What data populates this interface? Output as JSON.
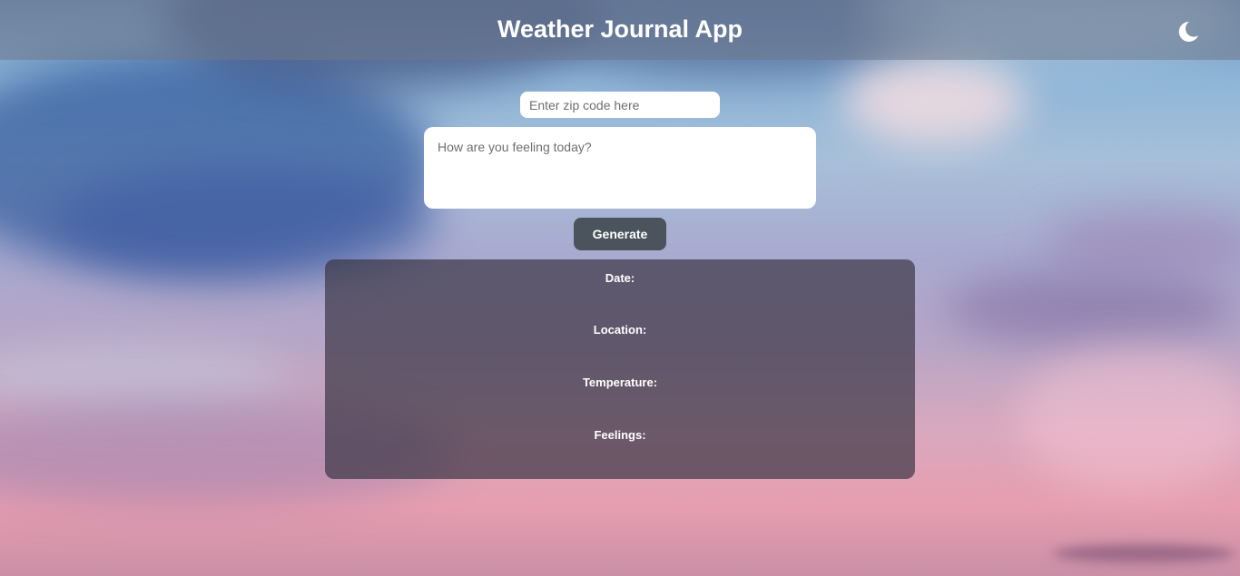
{
  "app": {
    "title": "Weather Journal App"
  },
  "header": {
    "theme_toggle_icon": "moon-icon"
  },
  "form": {
    "zip_placeholder": "Enter zip code here",
    "zip_value": "",
    "feelings_placeholder": "How are you feeling today?",
    "feelings_value": "",
    "generate_label": "Generate"
  },
  "results": {
    "date_label": "Date:",
    "location_label": "Location:",
    "temperature_label": "Temperature:",
    "feelings_label": "Feelings:"
  },
  "colors": {
    "header_bg": "#6e788c",
    "button_bg": "#4b535c",
    "panel_bg": "#373241",
    "text": "#ffffff"
  }
}
